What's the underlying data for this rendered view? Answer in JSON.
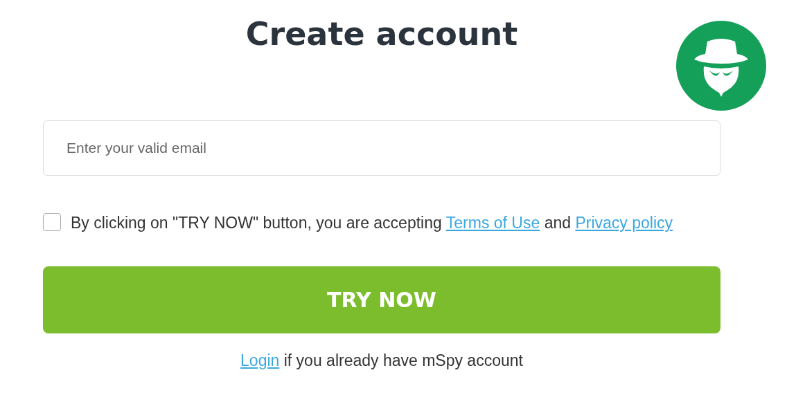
{
  "title": "Create account",
  "email_field": {
    "placeholder": "Enter your valid email"
  },
  "consent": {
    "checked": false,
    "parts": [
      {
        "kind": "text",
        "text": "By clicking on \"TRY NOW\" button, you are accepting "
      },
      {
        "kind": "link",
        "text": "Terms of Use"
      },
      {
        "kind": "text",
        "text": " and "
      },
      {
        "kind": "link",
        "text": "Privacy policy"
      }
    ]
  },
  "submit_button": "TRY NOW",
  "login_line": [
    {
      "kind": "link",
      "text": "Login"
    },
    {
      "kind": "text",
      "text": " if you already have mSpy account"
    }
  ]
}
